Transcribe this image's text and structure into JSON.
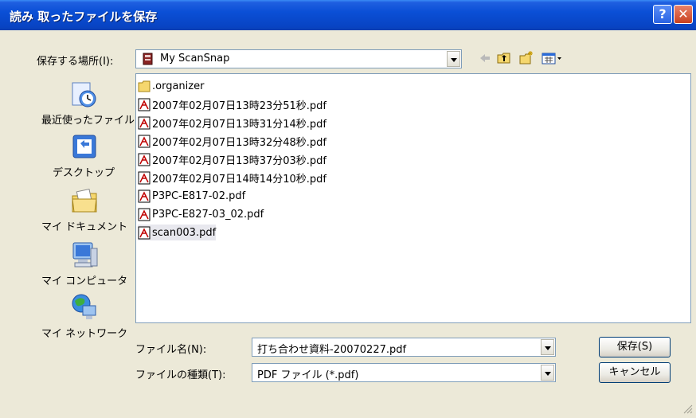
{
  "window": {
    "title": "読み 取ったファイルを保存"
  },
  "titlebar": {
    "help_label": "?",
    "close_label": "✕"
  },
  "location": {
    "label": "保存する場所(I):",
    "value": "My ScanSnap"
  },
  "toolbar": {
    "back_icon": "back-arrow-icon",
    "up_icon": "up-folder-icon",
    "new_folder_icon": "new-folder-icon",
    "views_icon": "views-menu-icon"
  },
  "places": [
    {
      "label": "最近使ったファイル",
      "icon": "recent-icon"
    },
    {
      "label": "デスクトップ",
      "icon": "desktop-icon"
    },
    {
      "label": "マイ ドキュメント",
      "icon": "my-documents-icon"
    },
    {
      "label": "マイ コンピュータ",
      "icon": "my-computer-icon"
    },
    {
      "label": "マイ ネットワーク",
      "icon": "my-network-icon"
    }
  ],
  "files": [
    {
      "name": ".organizer",
      "type": "folder"
    },
    {
      "name": "2007年02月07日13時23分51秒.pdf",
      "type": "pdf"
    },
    {
      "name": "2007年02月07日13時31分14秒.pdf",
      "type": "pdf"
    },
    {
      "name": "2007年02月07日13時32分48秒.pdf",
      "type": "pdf"
    },
    {
      "name": "2007年02月07日13時37分03秒.pdf",
      "type": "pdf"
    },
    {
      "name": "2007年02月07日14時14分10秒.pdf",
      "type": "pdf"
    },
    {
      "name": "P3PC-E817-02.pdf",
      "type": "pdf"
    },
    {
      "name": "P3PC-E827-03_02.pdf",
      "type": "pdf"
    },
    {
      "name": "scan003.pdf",
      "type": "pdf",
      "selected": true
    }
  ],
  "filename": {
    "label": "ファイル名(N):",
    "value": "打ち合わせ資料-20070227.pdf"
  },
  "filetype": {
    "label": "ファイルの種類(T):",
    "value": "PDF ファイル (*.pdf)"
  },
  "buttons": {
    "save": "保存(S)",
    "cancel": "キャンセル"
  }
}
